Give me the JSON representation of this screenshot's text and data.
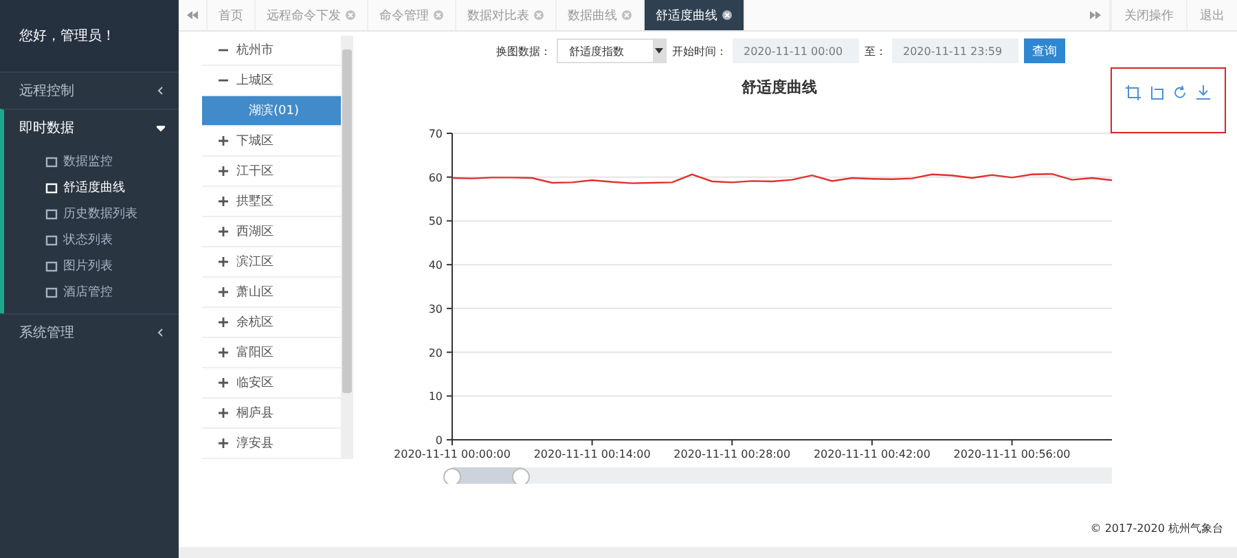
{
  "sidebar": {
    "greeting": "您好，管理员！",
    "items": [
      {
        "label": "远程控制",
        "expanded": false
      },
      {
        "label": "即时数据",
        "expanded": true,
        "children": [
          {
            "label": "数据监控",
            "selected": false
          },
          {
            "label": "舒适度曲线",
            "selected": true
          },
          {
            "label": "历史数据列表",
            "selected": false
          },
          {
            "label": "状态列表",
            "selected": false
          },
          {
            "label": "图片列表",
            "selected": false
          },
          {
            "label": "酒店管控",
            "selected": false
          }
        ]
      },
      {
        "label": "系统管理",
        "expanded": false
      }
    ]
  },
  "tabs": [
    {
      "label": "首页",
      "closable": false,
      "selected": false
    },
    {
      "label": "远程命令下发",
      "closable": true,
      "selected": false
    },
    {
      "label": "命令管理",
      "closable": true,
      "selected": false
    },
    {
      "label": "数据对比表",
      "closable": true,
      "selected": false
    },
    {
      "label": "数据曲线",
      "closable": true,
      "selected": false
    },
    {
      "label": "舒适度曲线",
      "closable": true,
      "selected": true
    }
  ],
  "tab_actions": [
    "关闭操作",
    "退出"
  ],
  "tree": [
    {
      "label": "杭州市",
      "expanded": true,
      "children": [
        {
          "label": "上城区",
          "expanded": true,
          "children": [
            {
              "label": "湖滨(01)",
              "selected": true
            }
          ]
        },
        {
          "label": "下城区",
          "expanded": false
        },
        {
          "label": "江干区",
          "expanded": false
        },
        {
          "label": "拱墅区",
          "expanded": false
        },
        {
          "label": "西湖区",
          "expanded": false
        },
        {
          "label": "滨江区",
          "expanded": false
        },
        {
          "label": "萧山区",
          "expanded": false
        },
        {
          "label": "余杭区",
          "expanded": false
        },
        {
          "label": "富阳区",
          "expanded": false
        },
        {
          "label": "临安区",
          "expanded": false
        },
        {
          "label": "桐庐县",
          "expanded": false
        },
        {
          "label": "淳安县",
          "expanded": false
        }
      ]
    }
  ],
  "filter": {
    "data_label": "换图数据：",
    "data_value": "舒适度指数",
    "start_label": "开始时间：",
    "start_value": "2020-11-11 00:00",
    "to_label": "至：",
    "end_value": "2020-11-11 23:59",
    "button": "查询"
  },
  "chart": {
    "chart_data": {
      "type": "line",
      "title": "舒适度曲线",
      "grid": true,
      "categories": [
        "2020-11-11 00:00:00",
        null,
        null,
        null,
        null,
        null,
        null,
        "2020-11-11 00:14:00",
        null,
        null,
        null,
        null,
        null,
        null,
        "2020-11-11 00:28:00",
        null,
        null,
        null,
        null,
        null,
        null,
        "2020-11-11 00:42:00",
        null,
        null,
        null,
        null,
        null,
        null,
        "2020-11-11 00:56:00",
        null,
        null,
        null,
        null,
        null
      ],
      "series": [
        {
          "color": "#e03030",
          "values": [
            59.8,
            59.7,
            59.9,
            59.9,
            59.8,
            58.7,
            58.8,
            59.3,
            58.9,
            58.6,
            58.7,
            58.8,
            60.6,
            59.0,
            58.8,
            59.1,
            59.0,
            59.4,
            60.4,
            59.1,
            59.8,
            59.6,
            59.5,
            59.7,
            60.6,
            60.4,
            59.8,
            60.5,
            59.9,
            60.6,
            60.7,
            59.4,
            59.8,
            59.3
          ]
        }
      ],
      "ylim": [
        0,
        70
      ],
      "yticks": [
        0,
        10,
        20,
        30,
        40,
        50,
        60,
        70
      ]
    }
  },
  "footer": "© 2017-2020 杭州气象台"
}
